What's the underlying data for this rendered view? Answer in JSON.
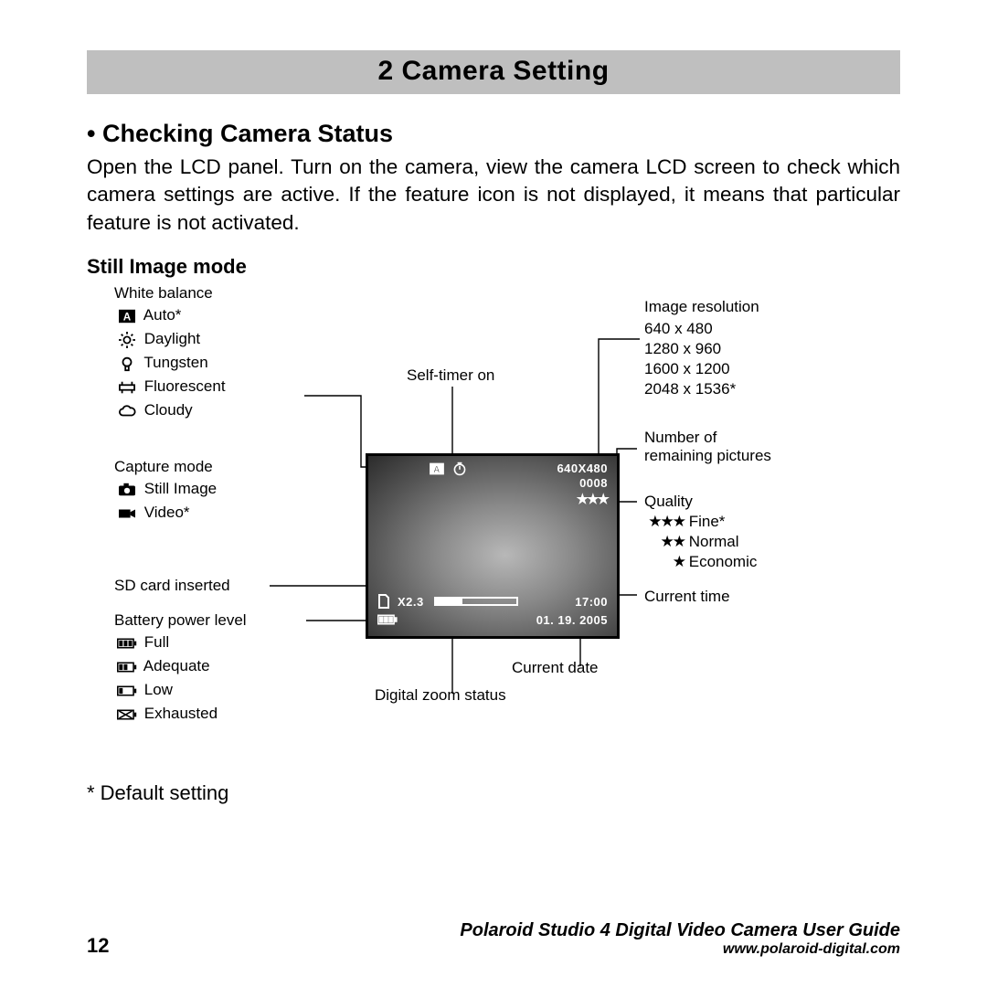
{
  "chapter": "2 Camera Setting",
  "section_bullet": "• Checking Camera Status",
  "body": "Open the LCD panel. Turn on the camera, view the camera LCD screen to check which camera settings are active. If the feature icon is not displayed, it means that particular feature is not activated.",
  "sub": "Still Image mode",
  "wb": {
    "title": "White balance",
    "auto": "Auto*",
    "daylight": "Daylight",
    "tungsten": "Tungsten",
    "fluorescent": "Fluorescent",
    "cloudy": "Cloudy"
  },
  "cap": {
    "title": "Capture mode",
    "still": "Still Image",
    "video": "Video*"
  },
  "sd_label": "SD card inserted",
  "bat": {
    "title": "Battery power level",
    "full": "Full",
    "adequate": "Adequate",
    "low": "Low",
    "exhausted": "Exhausted"
  },
  "selftimer": "Self-timer on",
  "zoom_label": "Digital zoom status",
  "date_label": "Current date",
  "res": {
    "title": "Image resolution",
    "r1": "640 x 480",
    "r2": "1280 x 960",
    "r3": "1600 x 1200",
    "r4": "2048 x 1536*"
  },
  "remain": "Number of\nremaining pictures",
  "qual": {
    "title": "Quality",
    "fine": "Fine*",
    "normal": "Normal",
    "economic": "Economic"
  },
  "time_label": "Current time",
  "note": "* Default setting",
  "lcd": {
    "res": "640X480",
    "count": "0008",
    "stars": "★★★",
    "zoom": "X2.3",
    "time": "17:00",
    "date": "01. 19. 2005"
  },
  "footer": {
    "page": "12",
    "guide": "Polaroid Studio 4 Digital Video Camera User Guide",
    "url": "www.polaroid-digital.com"
  }
}
